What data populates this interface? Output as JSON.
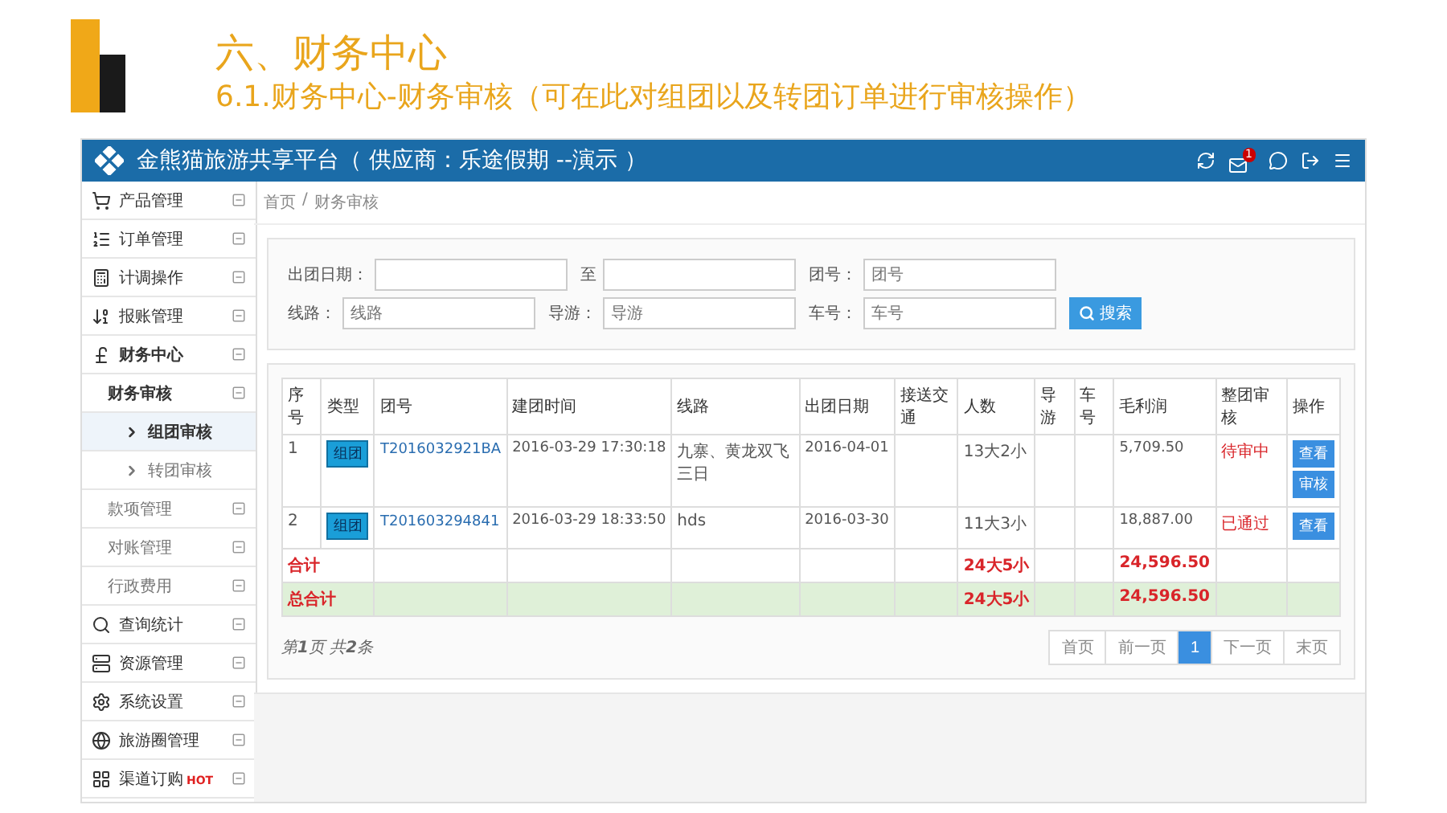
{
  "slide": {
    "title": "六、财务中心",
    "subtitle": "6.1.财务中心-财务审核（可在此对组团以及转团订单进行审核操作）"
  },
  "app": {
    "title": "金熊猫旅游共享平台（ 供应商：乐途假期 --演示 ）",
    "mail_badge": "1"
  },
  "sidebar": {
    "items": [
      {
        "label": "产品管理",
        "selected": false
      },
      {
        "label": "订单管理",
        "selected": false
      },
      {
        "label": "计调操作",
        "selected": false
      },
      {
        "label": "报账管理",
        "selected": false
      },
      {
        "label": "财务中心",
        "selected": false,
        "children": [
          {
            "label": "财务审核",
            "selected": false,
            "children": [
              {
                "label": "组团审核",
                "selected": true
              },
              {
                "label": "转团审核",
                "selected": false
              }
            ]
          },
          {
            "label": "款项管理",
            "selected": false
          },
          {
            "label": "对账管理",
            "selected": false
          },
          {
            "label": "行政费用",
            "selected": false
          }
        ]
      },
      {
        "label": "查询统计",
        "selected": false
      },
      {
        "label": "资源管理",
        "selected": false
      },
      {
        "label": "系统设置",
        "selected": false
      },
      {
        "label": "旅游圈管理",
        "selected": false
      },
      {
        "label": "渠道订购",
        "selected": false,
        "badge": "HOT"
      }
    ]
  },
  "breadcrumb": {
    "items": [
      "首页",
      "财务审核"
    ],
    "separator": "/"
  },
  "filters": {
    "rows": [
      [
        {
          "label": "出团日期："
        },
        {
          "label": "至"
        },
        {
          "label": "团号：",
          "placeholder": "团号"
        }
      ],
      [
        {
          "label": "线路：",
          "placeholder": "线路"
        },
        {
          "label": "导游：",
          "placeholder": "导游"
        },
        {
          "label": "车号：",
          "placeholder": "车号"
        }
      ]
    ],
    "search_button": "搜索"
  },
  "table": {
    "columns": [
      "序号",
      "类型",
      "团号",
      "建团时间",
      "线路",
      "出团日期",
      "接送交通",
      "人数",
      "导游",
      "车号",
      "毛利润",
      "整团审核",
      "操作"
    ],
    "rows": [
      {
        "index": "1",
        "type": "组团",
        "group_no": "T2016032921BA",
        "created": "2016-03-29 17:30:18",
        "route": "九寨、黄龙双飞三日",
        "depart": "2016-04-01",
        "people": "13大2小",
        "profit": "5,709.50",
        "audit": "待审中",
        "actions": [
          "查看",
          "审核"
        ]
      },
      {
        "index": "2",
        "type": "组团",
        "group_no": "T201603294841",
        "created": "2016-03-29 18:33:50",
        "route": "hds",
        "depart": "2016-03-30",
        "people": "11大3小",
        "profit": "18,887.00",
        "audit": "已通过",
        "actions": [
          "查看"
        ]
      }
    ],
    "totals": [
      {
        "label": "合计",
        "people": "24大5小",
        "profit": "24,596.50",
        "highlight": false
      },
      {
        "label": "总合计",
        "people": "24大5小",
        "profit": "24,596.50",
        "highlight": true
      }
    ]
  },
  "pagination": {
    "info": "第**1**页 共**2**条",
    "pages": [
      {
        "label": "首页",
        "selected": false
      },
      {
        "label": "前一页",
        "selected": false
      },
      {
        "label": "1",
        "selected": true
      },
      {
        "label": "下一页",
        "selected": false
      },
      {
        "label": "末页",
        "selected": false
      }
    ]
  }
}
